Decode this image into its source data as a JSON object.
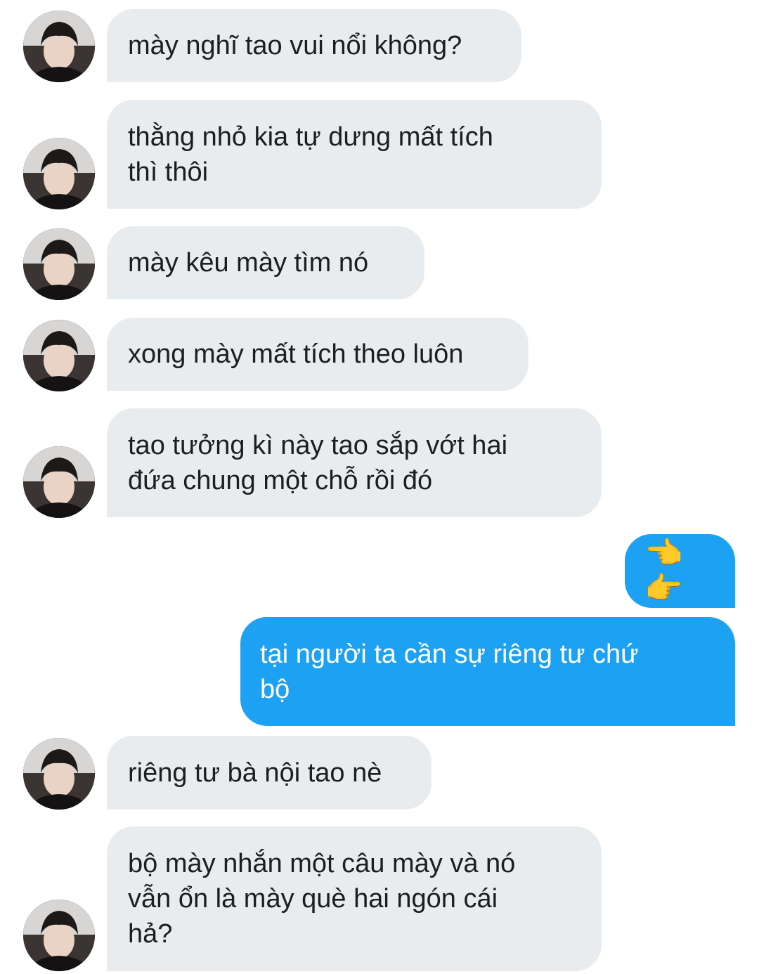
{
  "conversation": {
    "messages": [
      {
        "direction": "incoming",
        "text": "mày nghĩ tao vui nổi không?"
      },
      {
        "direction": "incoming",
        "text": "thằng nhỏ kia tự dưng mất tích\nthì thôi"
      },
      {
        "direction": "incoming",
        "text": "mày kêu mày tìm nó"
      },
      {
        "direction": "incoming",
        "text": "xong mày mất tích theo luôn"
      },
      {
        "direction": "incoming",
        "text": "tao tưởng kì này tao sắp vớt hai\nđứa chung một chỗ rồi đó"
      },
      {
        "direction": "outgoing",
        "text": "👈👉"
      },
      {
        "direction": "outgoing",
        "text": "tại người ta cần sự riêng tư chứ\nbộ"
      },
      {
        "direction": "incoming",
        "text": "riêng tư bà nội tao nè"
      },
      {
        "direction": "incoming",
        "text": "bộ mày nhắn một câu mày và nó\nvẫn ổn là mày què hai ngón cái\nhả?"
      }
    ]
  },
  "colors": {
    "incoming_bubble": "#e9ecef",
    "outgoing_bubble": "#1da1f2",
    "incoming_text": "#1c1e21",
    "outgoing_text": "#ffffff"
  },
  "icons": {
    "avatar": "user-photo-avatar",
    "emoji_left": "backhand-index-pointing-left",
    "emoji_right": "backhand-index-pointing-right"
  }
}
